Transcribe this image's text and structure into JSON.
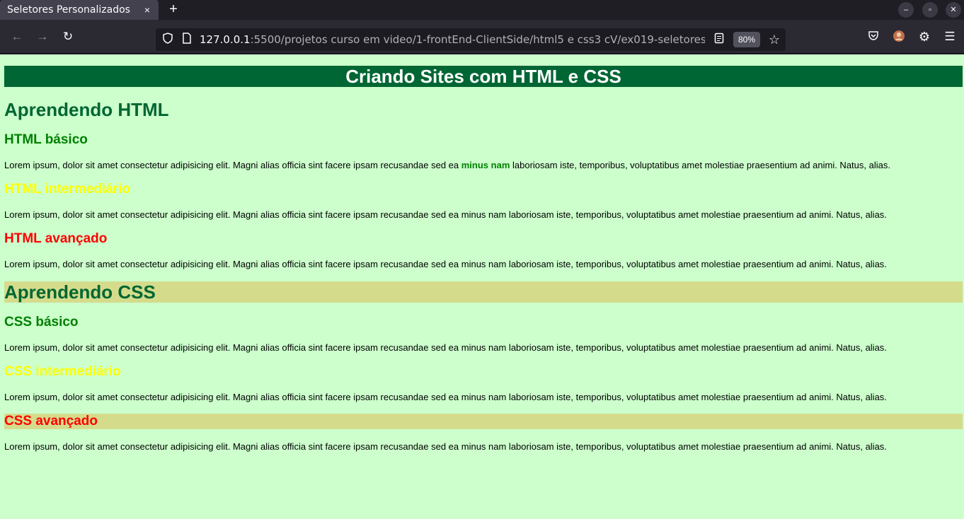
{
  "browser": {
    "tab_title": "Seletores Personalizados",
    "tab_close": "×",
    "new_tab": "+",
    "url_host": "127.0.0.1",
    "url_path": ":5500/projetos curso em video/1-frontEnd-ClientSide/html5 e css3 cV/ex019-seletores-person",
    "zoom": "80%"
  },
  "page": {
    "title": "Criando Sites com HTML e CSS",
    "html_section": {
      "heading": "Aprendendo HTML",
      "basic": {
        "heading": "HTML básico",
        "text_before": "Lorem ipsum, dolor sit amet consectetur adipisicing elit. Magni alias officia sint facere ipsam recusandae sed ea ",
        "strong": "minus nam",
        "text_after": " laboriosam iste, temporibus, voluptatibus amet molestiae praesentium ad animi. Natus, alias."
      },
      "intermediate": {
        "heading": "HTML intermediário",
        "text": "Lorem ipsum, dolor sit amet consectetur adipisicing elit. Magni alias officia sint facere ipsam recusandae sed ea minus nam laboriosam iste, temporibus, voluptatibus amet molestiae praesentium ad animi. Natus, alias."
      },
      "advanced": {
        "heading": "HTML avançado",
        "text": "Lorem ipsum, dolor sit amet consectetur adipisicing elit. Magni alias officia sint facere ipsam recusandae sed ea minus nam laboriosam iste, temporibus, voluptatibus amet molestiae praesentium ad animi. Natus, alias."
      }
    },
    "css_section": {
      "heading": "Aprendendo CSS",
      "basic": {
        "heading": "CSS básico",
        "text": "Lorem ipsum, dolor sit amet consectetur adipisicing elit. Magni alias officia sint facere ipsam recusandae sed ea minus nam laboriosam iste, temporibus, voluptatibus amet molestiae praesentium ad animi. Natus, alias."
      },
      "intermediate": {
        "heading": "CSS intermediário",
        "text": "Lorem ipsum, dolor sit amet consectetur adipisicing elit. Magni alias officia sint facere ipsam recusandae sed ea minus nam laboriosam iste, temporibus, voluptatibus amet molestiae praesentium ad animi. Natus, alias."
      },
      "advanced": {
        "heading": "CSS avançado",
        "text": "Lorem ipsum, dolor sit amet consectetur adipisicing elit. Magni alias officia sint facere ipsam recusandae sed ea minus nam laboriosam iste, temporibus, voluptatibus amet molestiae praesentium ad animi. Natus, alias."
      }
    }
  },
  "colors": {
    "page_bg": "#ccffcc",
    "title_bg": "#006633",
    "highlight_bg": "#d4dc8c",
    "basic": "#008000",
    "intermediate": "#ffff00",
    "advanced": "#ff0000"
  },
  "icons": [
    "back-arrow-icon",
    "forward-arrow-icon",
    "reload-icon",
    "shield-icon",
    "page-icon",
    "reader-view-icon",
    "bookmark-star-icon",
    "pocket-icon",
    "account-avatar-icon",
    "extensions-gear-icon",
    "menu-icon"
  ]
}
